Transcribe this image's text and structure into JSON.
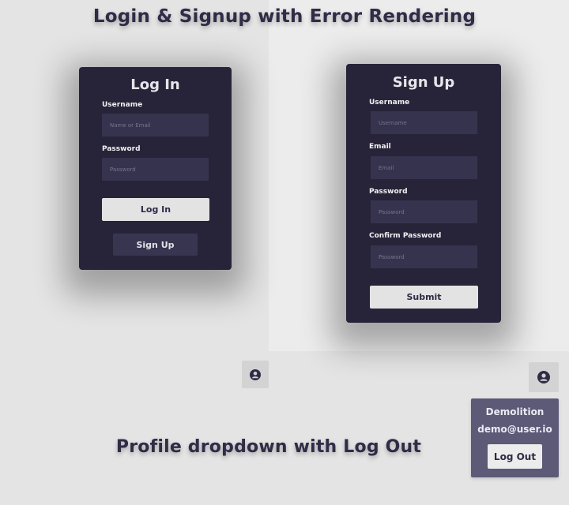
{
  "headings": {
    "top": "Login & Signup with Error Rendering",
    "bottom": "Profile dropdown with Log Out"
  },
  "login": {
    "title": "Log In",
    "username_label": "Username",
    "username_placeholder": "Name or Email",
    "password_label": "Password",
    "password_placeholder": "Password",
    "login_button": "Log In",
    "signup_button": "Sign Up"
  },
  "signup": {
    "title": "Sign Up",
    "username_label": "Username",
    "username_placeholder": "Username",
    "email_label": "Email",
    "email_placeholder": "Email",
    "password_label": "Password",
    "password_placeholder": "Password",
    "confirm_label": "Confirm Password",
    "confirm_placeholder": "Password",
    "submit_button": "Submit"
  },
  "profile": {
    "icon": "user-circle-icon",
    "name": "Demolition",
    "email": "demo@user.io",
    "logout_button": "Log Out"
  },
  "colors": {
    "card_bg": "#27243a",
    "input_bg": "#35334d",
    "dropdown_bg": "#5c5a77",
    "page_bg": "#e4e4e4"
  }
}
